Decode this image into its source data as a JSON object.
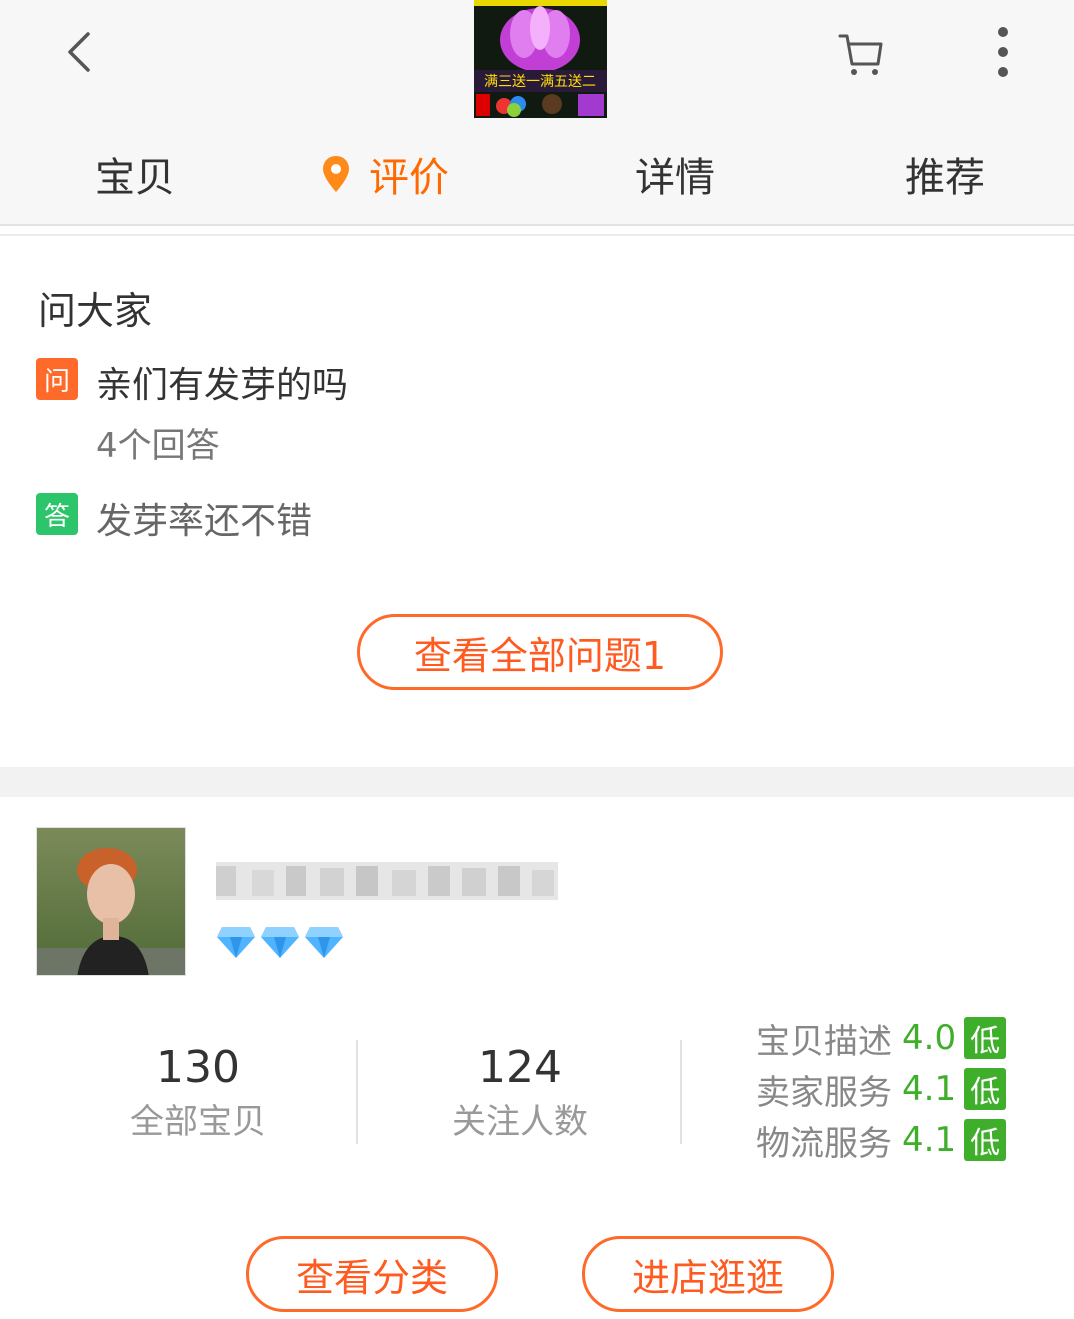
{
  "header": {
    "back_icon": "chevron-left-icon",
    "cart_icon": "cart-icon",
    "more_icon": "more-vertical-icon",
    "banner_text": "满三送一满五送二",
    "tabs": [
      {
        "label": "宝贝",
        "active": false
      },
      {
        "label": "评价",
        "active": true,
        "icon": "location-pin-icon"
      },
      {
        "label": "详情",
        "active": false
      },
      {
        "label": "推荐",
        "active": false
      }
    ],
    "accent_color": "#ff6a00"
  },
  "ask": {
    "title": "问大家",
    "question_tag": "问",
    "question": "亲们有发芽的吗",
    "answer_count": "4个回答",
    "answer_tag": "答",
    "answer": "发芽率还不错",
    "view_all_label": "查看全部问题1"
  },
  "shop": {
    "diamond_count": 3,
    "stats": [
      {
        "value": "130",
        "label": "全部宝贝"
      },
      {
        "value": "124",
        "label": "关注人数"
      }
    ],
    "ratings": [
      {
        "label": "宝贝描述",
        "score": "4.0",
        "level": "低"
      },
      {
        "label": "卖家服务",
        "score": "4.1",
        "level": "低"
      },
      {
        "label": "物流服务",
        "score": "4.1",
        "level": "低"
      }
    ],
    "category_button": "查看分类",
    "enter_shop_button": "进店逛逛",
    "rating_color": "#3fae2a"
  }
}
